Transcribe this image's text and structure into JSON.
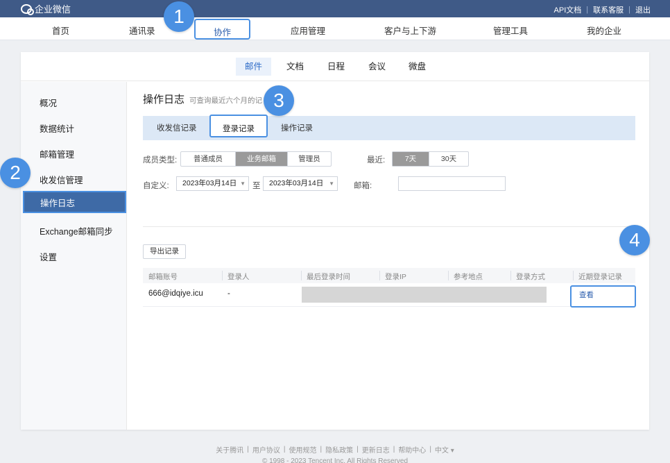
{
  "topbar": {
    "logo_text": "企业微信",
    "links": [
      "API文档",
      "联系客服",
      "退出"
    ]
  },
  "nav": {
    "items": [
      "首页",
      "通讯录",
      "协作",
      "应用管理",
      "客户与上下游",
      "管理工具",
      "我的企业"
    ],
    "active": "协作"
  },
  "subtabs": [
    "邮件",
    "文档",
    "日程",
    "会议",
    "微盘"
  ],
  "sidebar": {
    "items": [
      "概况",
      "数据统计",
      "邮箱管理",
      "收发信管理",
      "操作日志",
      "Exchange邮箱同步",
      "设置"
    ],
    "active": "操作日志"
  },
  "main": {
    "title": "操作日志",
    "hint": "可查询最近六个月的记录",
    "log_tabs": [
      "收发信记录",
      "登录记录",
      "操作记录"
    ],
    "member_type_label": "成员类型:",
    "member_types": [
      "普通成员",
      "业务邮箱",
      "管理员"
    ],
    "recent_label": "最近:",
    "recent_options": [
      "7天",
      "30天"
    ],
    "custom_label": "自定义:",
    "date_from": "2023年03月14日",
    "to_label": "至",
    "date_to": "2023年03月14日",
    "mailbox_label": "邮箱:",
    "mailbox_value": "",
    "export_label": "导出记录",
    "table": {
      "headers": [
        "邮箱账号",
        "登录人",
        "最后登录时间",
        "登录IP",
        "参考地点",
        "登录方式",
        "近期登录记录"
      ],
      "rows": [
        {
          "account": "666@idqiye.icu",
          "user": "-",
          "action": "查看"
        }
      ]
    }
  },
  "badges": [
    "1",
    "2",
    "3",
    "4"
  ],
  "footer": {
    "links": [
      "关于腾讯",
      "用户协议",
      "使用规范",
      "隐私政策",
      "更新日志",
      "帮助中心",
      "中文 ▾"
    ],
    "copyright": "© 1998 - 2023 Tencent Inc. All Rights Reserved"
  },
  "colors": {
    "topbar": "#3f5a87",
    "accent": "#4a90e2",
    "sidebar_active": "#3e6aa6",
    "log_tabs_bg": "#dce8f6"
  }
}
